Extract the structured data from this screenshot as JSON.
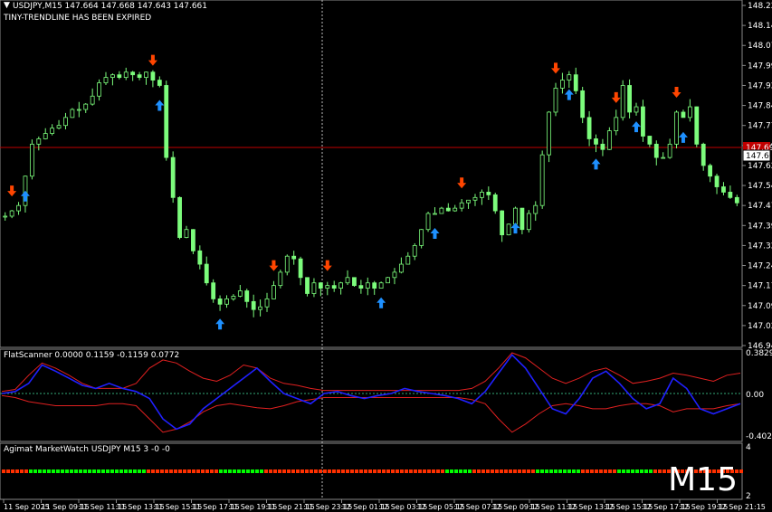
{
  "symbol_header": "USDJPY,M15  147.664 147.668 147.643 147.661",
  "status_message": "TINY-TRENDLINE HAS BEEN EXPIRED",
  "timeframe_badge": "M15",
  "current_price_label": "147.661",
  "partial_price_label": "147.695",
  "main_price_axis": [
    "148.220",
    "148.145",
    "148.070",
    "147.995",
    "147.920",
    "147.845",
    "147.770",
    "147.695",
    "147.620",
    "147.545",
    "147.470",
    "147.395",
    "147.320",
    "147.245",
    "147.170",
    "147.095",
    "147.020",
    "146.945"
  ],
  "indicator1": {
    "title": "FlatScanner 0.0000 0.1159 -0.1159 0.0772",
    "axis": [
      "0.3829",
      "0.00",
      "-0.4028"
    ]
  },
  "indicator2": {
    "title": "Agimat MarketWatch USDJPY M15 3 -0 -0",
    "axis": [
      "4",
      "2"
    ]
  },
  "time_axis": [
    "11 Sep 2025",
    "11 Sep 09:15",
    "11 Sep 11:15",
    "11 Sep 13:15",
    "11 Sep 15:15",
    "11 Sep 17:15",
    "11 Sep 19:15",
    "11 Sep 21:15",
    "11 Sep 23:15",
    "12 Sep 01:15",
    "12 Sep 03:15",
    "12 Sep 05:15",
    "12 Sep 07:15",
    "12 Sep 09:15",
    "12 Sep 11:15",
    "12 Sep 13:15",
    "12 Sep 15:15",
    "12 Sep 17:15",
    "12 Sep 19:15",
    "12 Sep 21:15"
  ],
  "colors": {
    "candle": "#7CFC7C",
    "up_arrow": "#1E90FF",
    "down_arrow": "#FF4500",
    "line_red": "#E02020",
    "line_blue": "#2020FF",
    "bar_green": "#00FF00",
    "bar_red": "#FF3000"
  },
  "chart_data": {
    "type": "line",
    "title": "USDJPY,M15",
    "series": [
      {
        "name": "USDJPY",
        "values": [
          147.43,
          147.45,
          147.47,
          147.58,
          147.7,
          147.72,
          147.74,
          147.76,
          147.77,
          147.8,
          147.83,
          147.83,
          147.85,
          147.88,
          147.93,
          147.95,
          147.96,
          147.95,
          147.97,
          147.96,
          147.95,
          147.97,
          147.94,
          147.92,
          147.65,
          147.5,
          147.35,
          147.38,
          147.3,
          147.25,
          147.18,
          147.12,
          147.1,
          147.12,
          147.13,
          147.15,
          147.11,
          147.08,
          147.09,
          147.12,
          147.17,
          147.22,
          147.28,
          147.27,
          147.2,
          147.14,
          147.18,
          147.16,
          147.17,
          147.16,
          147.18,
          147.2,
          147.17,
          147.16,
          147.18,
          147.16,
          147.18,
          147.2,
          147.22,
          147.25,
          147.28,
          147.32,
          147.38,
          147.44,
          147.44,
          147.46,
          147.45,
          147.46,
          147.48,
          147.49,
          147.5,
          147.52,
          147.51,
          147.45,
          147.36,
          147.4,
          147.46,
          147.38,
          147.44,
          147.47,
          147.66,
          147.82,
          147.91,
          147.94,
          147.96,
          147.9,
          147.8,
          147.72,
          147.7,
          147.68,
          147.75,
          147.8,
          147.92,
          147.82,
          147.84,
          147.73,
          147.7,
          147.65,
          147.65,
          147.7,
          147.82,
          147.8,
          147.84,
          147.7,
          147.62,
          147.58,
          147.54,
          147.52,
          147.5,
          147.48
        ]
      }
    ],
    "ylim": [
      146.945,
      148.22
    ],
    "indicator_series": {
      "blue": [
        0.0,
        0.02,
        0.1,
        0.28,
        0.22,
        0.15,
        0.08,
        0.05,
        0.1,
        0.05,
        0.02,
        -0.05,
        -0.25,
        -0.35,
        -0.3,
        -0.15,
        -0.05,
        0.05,
        0.15,
        0.25,
        0.12,
        0.0,
        -0.05,
        -0.1,
        0.0,
        0.02,
        -0.02,
        -0.05,
        -0.02,
        0.0,
        0.05,
        0.02,
        0.0,
        -0.02,
        -0.05,
        -0.1,
        0.02,
        0.2,
        0.38,
        0.25,
        0.05,
        -0.15,
        -0.2,
        -0.05,
        0.15,
        0.22,
        0.1,
        -0.05,
        -0.15,
        -0.1,
        0.15,
        0.05,
        -0.15,
        -0.2,
        -0.15,
        -0.1
      ],
      "red_upper": [
        0.02,
        0.04,
        0.18,
        0.3,
        0.25,
        0.18,
        0.1,
        0.05,
        0.05,
        0.05,
        0.1,
        0.25,
        0.33,
        0.3,
        0.22,
        0.15,
        0.12,
        0.18,
        0.28,
        0.25,
        0.15,
        0.1,
        0.08,
        0.05,
        0.03,
        0.03,
        0.03,
        0.03,
        0.03,
        0.03,
        0.03,
        0.03,
        0.03,
        0.03,
        0.03,
        0.05,
        0.12,
        0.25,
        0.4,
        0.35,
        0.25,
        0.15,
        0.1,
        0.15,
        0.22,
        0.25,
        0.18,
        0.1,
        0.12,
        0.15,
        0.2,
        0.18,
        0.15,
        0.12,
        0.18,
        0.2
      ],
      "red_lower": [
        -0.02,
        -0.04,
        -0.08,
        -0.1,
        -0.12,
        -0.12,
        -0.12,
        -0.12,
        -0.1,
        -0.1,
        -0.12,
        -0.25,
        -0.38,
        -0.35,
        -0.28,
        -0.18,
        -0.12,
        -0.1,
        -0.12,
        -0.14,
        -0.15,
        -0.12,
        -0.08,
        -0.06,
        -0.04,
        -0.04,
        -0.04,
        -0.04,
        -0.04,
        -0.04,
        -0.04,
        -0.04,
        -0.04,
        -0.04,
        -0.04,
        -0.06,
        -0.1,
        -0.25,
        -0.38,
        -0.3,
        -0.2,
        -0.12,
        -0.1,
        -0.12,
        -0.15,
        -0.15,
        -0.12,
        -0.1,
        -0.1,
        -0.12,
        -0.18,
        -0.15,
        -0.15,
        -0.15,
        -0.12,
        -0.1
      ]
    }
  }
}
